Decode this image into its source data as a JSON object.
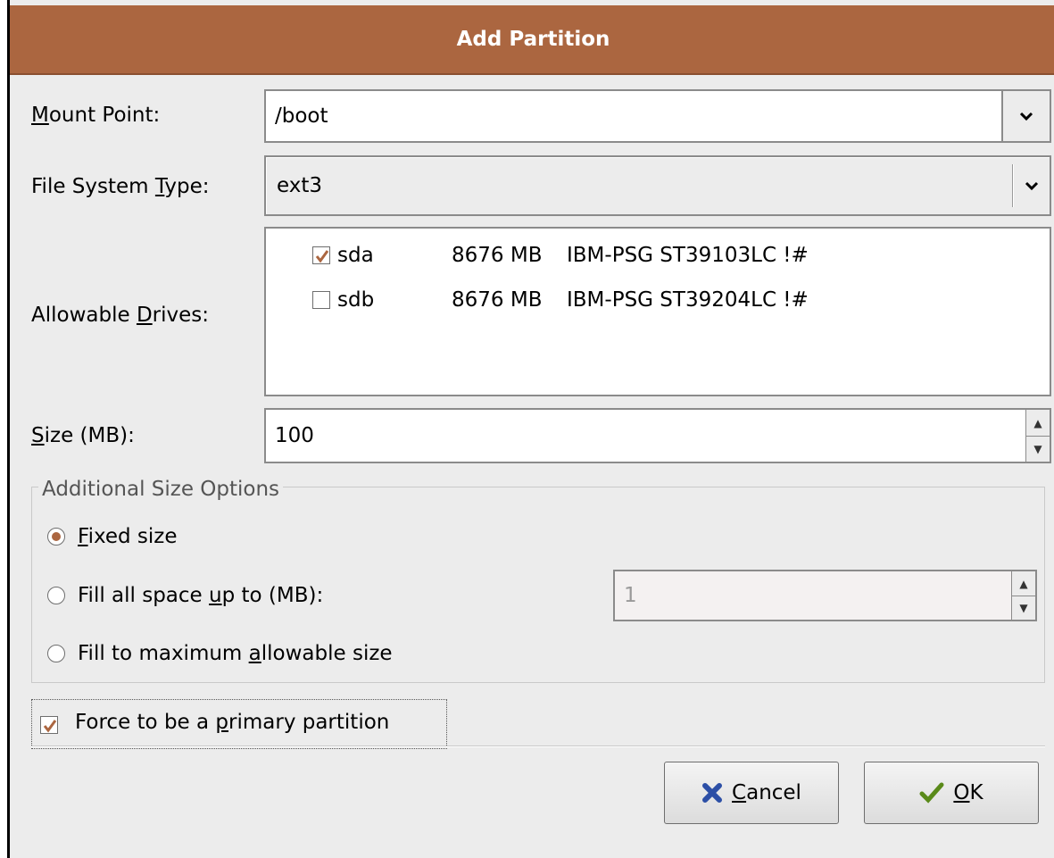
{
  "dialog": {
    "title": "Add Partition"
  },
  "mount_point": {
    "label_u": "M",
    "label_rest": "ount Point:",
    "value": "/boot"
  },
  "fs_type": {
    "label_pre": "File System ",
    "label_u": "T",
    "label_rest": "ype:",
    "value": "ext3"
  },
  "drives": {
    "label_pre": "Allowable ",
    "label_u": "D",
    "label_rest": "rives:",
    "items": [
      {
        "name": "sda",
        "size": "8676 MB",
        "model": "IBM-PSG ST39103LC !#",
        "checked": true
      },
      {
        "name": "sdb",
        "size": "8676 MB",
        "model": "IBM-PSG ST39204LC !#",
        "checked": false
      }
    ]
  },
  "size": {
    "label_u": "S",
    "label_rest": "ize (MB):",
    "value": "100"
  },
  "size_options": {
    "title": "Additional Size Options",
    "fixed": {
      "label_u": "F",
      "label_rest": "ixed size",
      "selected": true
    },
    "fill_upto": {
      "label_pre": "Fill all space ",
      "label_u": "u",
      "label_rest": "p to (MB):",
      "value": "1",
      "selected": false
    },
    "fill_max": {
      "label_pre": "Fill to maximum ",
      "label_u": "a",
      "label_rest": "llowable size",
      "selected": false
    }
  },
  "force_primary": {
    "label_pre": "Force to be a ",
    "label_u": "p",
    "label_rest": "rimary partition",
    "checked": true
  },
  "buttons": {
    "cancel": {
      "label_u": "C",
      "label_rest": "ancel"
    },
    "ok": {
      "label_u": "O",
      "label_rest": "K"
    }
  },
  "colors": {
    "accent": "#ab6640",
    "background": "#ececec"
  }
}
